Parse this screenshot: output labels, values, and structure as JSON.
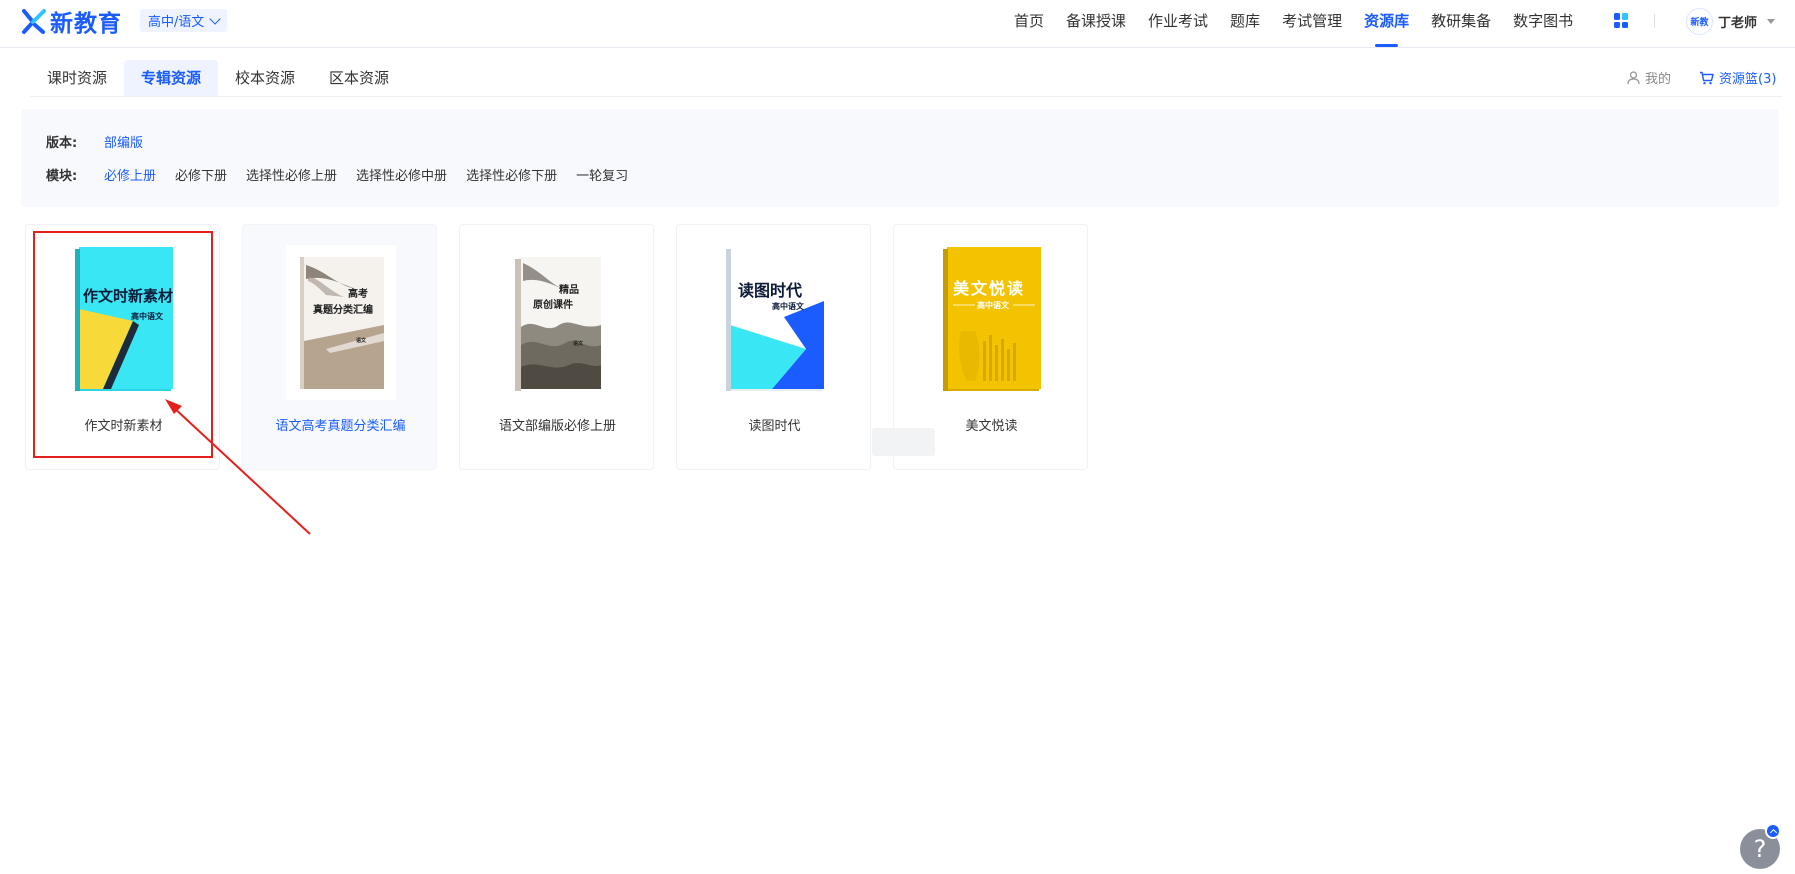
{
  "header": {
    "logo_text": "新教育",
    "subject_select": "高中/语文",
    "nav": [
      {
        "label": "首页",
        "active": false
      },
      {
        "label": "备课授课",
        "active": false
      },
      {
        "label": "作业考试",
        "active": false
      },
      {
        "label": "题库",
        "active": false
      },
      {
        "label": "考试管理",
        "active": false
      },
      {
        "label": "资源库",
        "active": true
      },
      {
        "label": "教研集备",
        "active": false
      },
      {
        "label": "数字图书",
        "active": false
      }
    ],
    "avatar_text": "新教",
    "user_name": "丁老师"
  },
  "subtabs": [
    {
      "label": "课时资源",
      "active": false
    },
    {
      "label": "专辑资源",
      "active": true
    },
    {
      "label": "校本资源",
      "active": false
    },
    {
      "label": "区本资源",
      "active": false
    }
  ],
  "toolbar": {
    "mine_label": "我的",
    "basket_label": "资源篮(3)"
  },
  "filter": {
    "edition_label": "版本:",
    "edition_options": [
      {
        "label": "部编版",
        "active": true
      }
    ],
    "module_label": "模块:",
    "module_options": [
      {
        "label": "必修上册",
        "active": true
      },
      {
        "label": "必修下册",
        "active": false
      },
      {
        "label": "选择性必修上册",
        "active": false
      },
      {
        "label": "选择性必修中册",
        "active": false
      },
      {
        "label": "选择性必修下册",
        "active": false
      },
      {
        "label": "一轮复习",
        "active": false
      }
    ]
  },
  "books": [
    {
      "title": "作文时新素材",
      "cover_main": "作文时新素材",
      "cover_sub": "高中语文",
      "highlighted": true
    },
    {
      "title": "语文高考真题分类汇编",
      "cover_main_1": "高考",
      "cover_main_2": "真题分类汇编",
      "cover_sub": "语文",
      "hover": true
    },
    {
      "title": "语文部编版必修上册",
      "cover_main_1": "精品",
      "cover_main_2": "原创课件",
      "cover_sub": "语文"
    },
    {
      "title": "读图时代",
      "cover_main": "读图时代",
      "cover_sub": "高中语文"
    },
    {
      "title": "美文悦读",
      "cover_main": "美文悦读",
      "cover_sub": "高中语文"
    }
  ],
  "colors": {
    "accent": "#1a5cff",
    "highlight_red": "#e5201c",
    "cyan": "#35e6f3",
    "yellow": "#f4c300"
  },
  "help_label": "?"
}
